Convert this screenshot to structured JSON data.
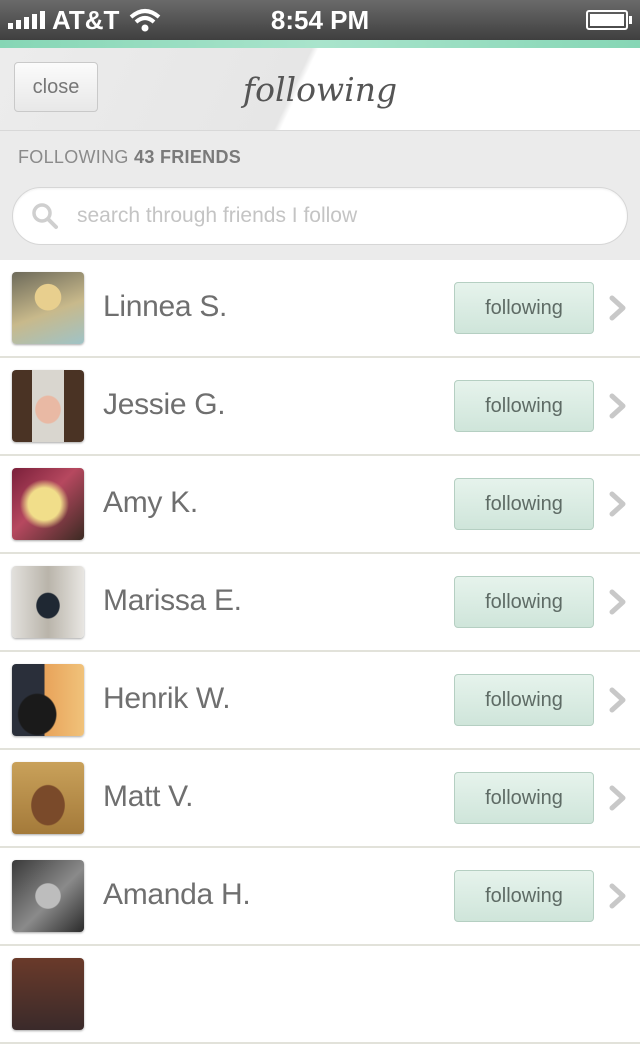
{
  "status_bar": {
    "carrier": "AT&T",
    "time": "8:54 PM"
  },
  "header": {
    "close_label": "close",
    "title": "following"
  },
  "summary": {
    "prefix": "FOLLOWING",
    "count_text": "43 FRIENDS"
  },
  "search": {
    "placeholder": "search through friends I follow"
  },
  "friends": [
    {
      "name": "Linnea S.",
      "button_label": "following"
    },
    {
      "name": "Jessie G.",
      "button_label": "following"
    },
    {
      "name": "Amy K.",
      "button_label": "following"
    },
    {
      "name": "Marissa E.",
      "button_label": "following"
    },
    {
      "name": "Henrik W.",
      "button_label": "following"
    },
    {
      "name": "Matt V.",
      "button_label": "following"
    },
    {
      "name": "Amanda H.",
      "button_label": "following"
    }
  ],
  "colors": {
    "accent_mint": "#86d6b5",
    "button_mint": "#d8ebe1"
  }
}
